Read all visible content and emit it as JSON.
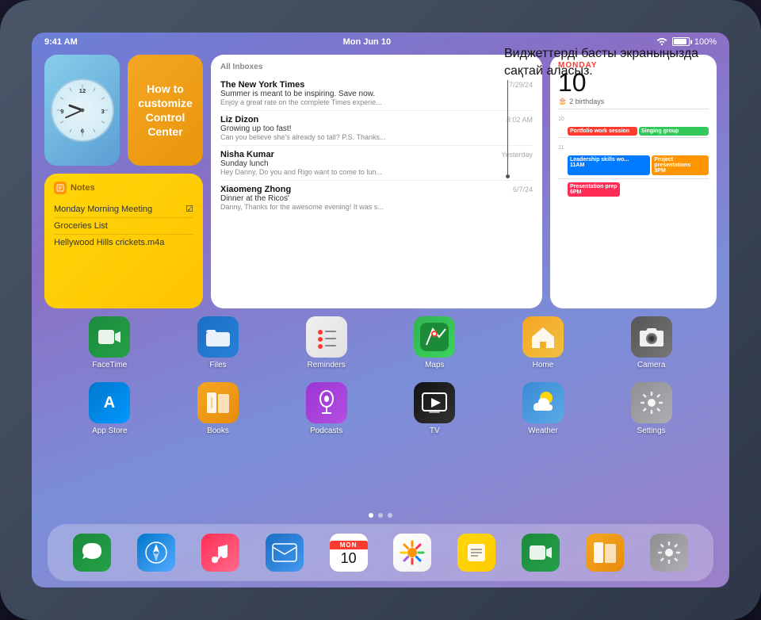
{
  "screen": {
    "status_bar": {
      "time": "9:41 AM",
      "date": "Mon Jun 10",
      "battery": "100%",
      "wifi_icon": "wifi-icon"
    },
    "tooltip": {
      "text": "Виджеттерді басты экраныңызда сақтай аласыз."
    }
  },
  "widgets": {
    "clock": {
      "label": "Clock",
      "aria": "clock-widget"
    },
    "control_center": {
      "title": "How to customize Control Center",
      "aria": "control-center-widget"
    },
    "notes": {
      "header": "Notes",
      "items": [
        {
          "text": "Monday Morning Meeting",
          "has_icon": true
        },
        {
          "text": "Groceries List",
          "has_icon": false
        },
        {
          "text": "Hellywood Hills crickets.m4a",
          "has_icon": false
        }
      ]
    },
    "mail": {
      "header": "All Inboxes",
      "emails": [
        {
          "sender": "The New York Times",
          "subject": "Summer is meant to be inspiring. Save now.",
          "preview": "Enjoy a great rate on the complete Times experie...",
          "date": "7/29/24"
        },
        {
          "sender": "Liz Dizon",
          "subject": "Growing up too fast!",
          "preview": "Can you believe she's already so tall? P.S. Thanks...",
          "date": "8:02 AM"
        },
        {
          "sender": "Nisha Kumar",
          "subject": "Sunday lunch",
          "preview": "Hey Danny, Do you and Rigo want to come to lun...",
          "date": "Yesterday"
        },
        {
          "sender": "Xiaomeng Zhong",
          "subject": "Dinner at the Ricos'",
          "preview": "Danny, Thanks for the awesome evening! It was s...",
          "date": "6/7/24"
        }
      ]
    },
    "calendar": {
      "day": "MONDAY",
      "date": "10",
      "birthdays": "2 birthdays",
      "events": [
        {
          "title": "Portfolio work session",
          "color": "red",
          "time": "10"
        },
        {
          "title": "Singing group",
          "color": "green",
          "time": "10"
        },
        {
          "title": "Leadership skills wo... 11AM",
          "color": "blue",
          "time": "11"
        },
        {
          "title": "Project presentations 3PM",
          "color": "orange",
          "time": "3"
        },
        {
          "title": "Presentation prep 6PM",
          "color": "pink",
          "time": "6"
        }
      ]
    }
  },
  "apps_row1": [
    {
      "label": "FaceTime",
      "class": "app-facetime",
      "icon": "📹"
    },
    {
      "label": "Files",
      "class": "app-files",
      "icon": "📁"
    },
    {
      "label": "Reminders",
      "class": "app-reminders",
      "icon": "📋"
    },
    {
      "label": "Maps",
      "class": "app-maps",
      "icon": "🗺"
    },
    {
      "label": "Home",
      "class": "app-home",
      "icon": "🏠"
    },
    {
      "label": "Camera",
      "class": "app-camera",
      "icon": "📷"
    }
  ],
  "apps_row2": [
    {
      "label": "App Store",
      "class": "app-appstore",
      "icon": "A"
    },
    {
      "label": "Books",
      "class": "app-books",
      "icon": "📖"
    },
    {
      "label": "Podcasts",
      "class": "app-podcasts",
      "icon": "🎙"
    },
    {
      "label": "TV",
      "class": "app-tv",
      "icon": "▶"
    },
    {
      "label": "Weather",
      "class": "app-weather",
      "icon": "⛅"
    },
    {
      "label": "Settings",
      "class": "app-settings",
      "icon": "⚙"
    }
  ],
  "dock": {
    "items": [
      {
        "label": "Messages",
        "class": "app-messages",
        "icon": "💬"
      },
      {
        "label": "Safari",
        "class": "app-safari",
        "icon": "🧭"
      },
      {
        "label": "Music",
        "class": "app-music",
        "icon": "🎵"
      },
      {
        "label": "Mail",
        "class": "app-mail",
        "icon": "✉"
      },
      {
        "label": "Calendar",
        "class": "app-calendar-dock",
        "icon": "Mon\n10"
      },
      {
        "label": "Photos",
        "class": "app-photos",
        "icon": "🌈"
      },
      {
        "label": "Notes",
        "class": "app-notes-dock",
        "icon": "📝"
      },
      {
        "label": "FaceTime",
        "class": "app-facetime",
        "icon": "📹"
      },
      {
        "label": "Books",
        "class": "app-books",
        "icon": "📖"
      },
      {
        "label": "Settings",
        "class": "app-settings",
        "icon": "⚙"
      }
    ]
  }
}
